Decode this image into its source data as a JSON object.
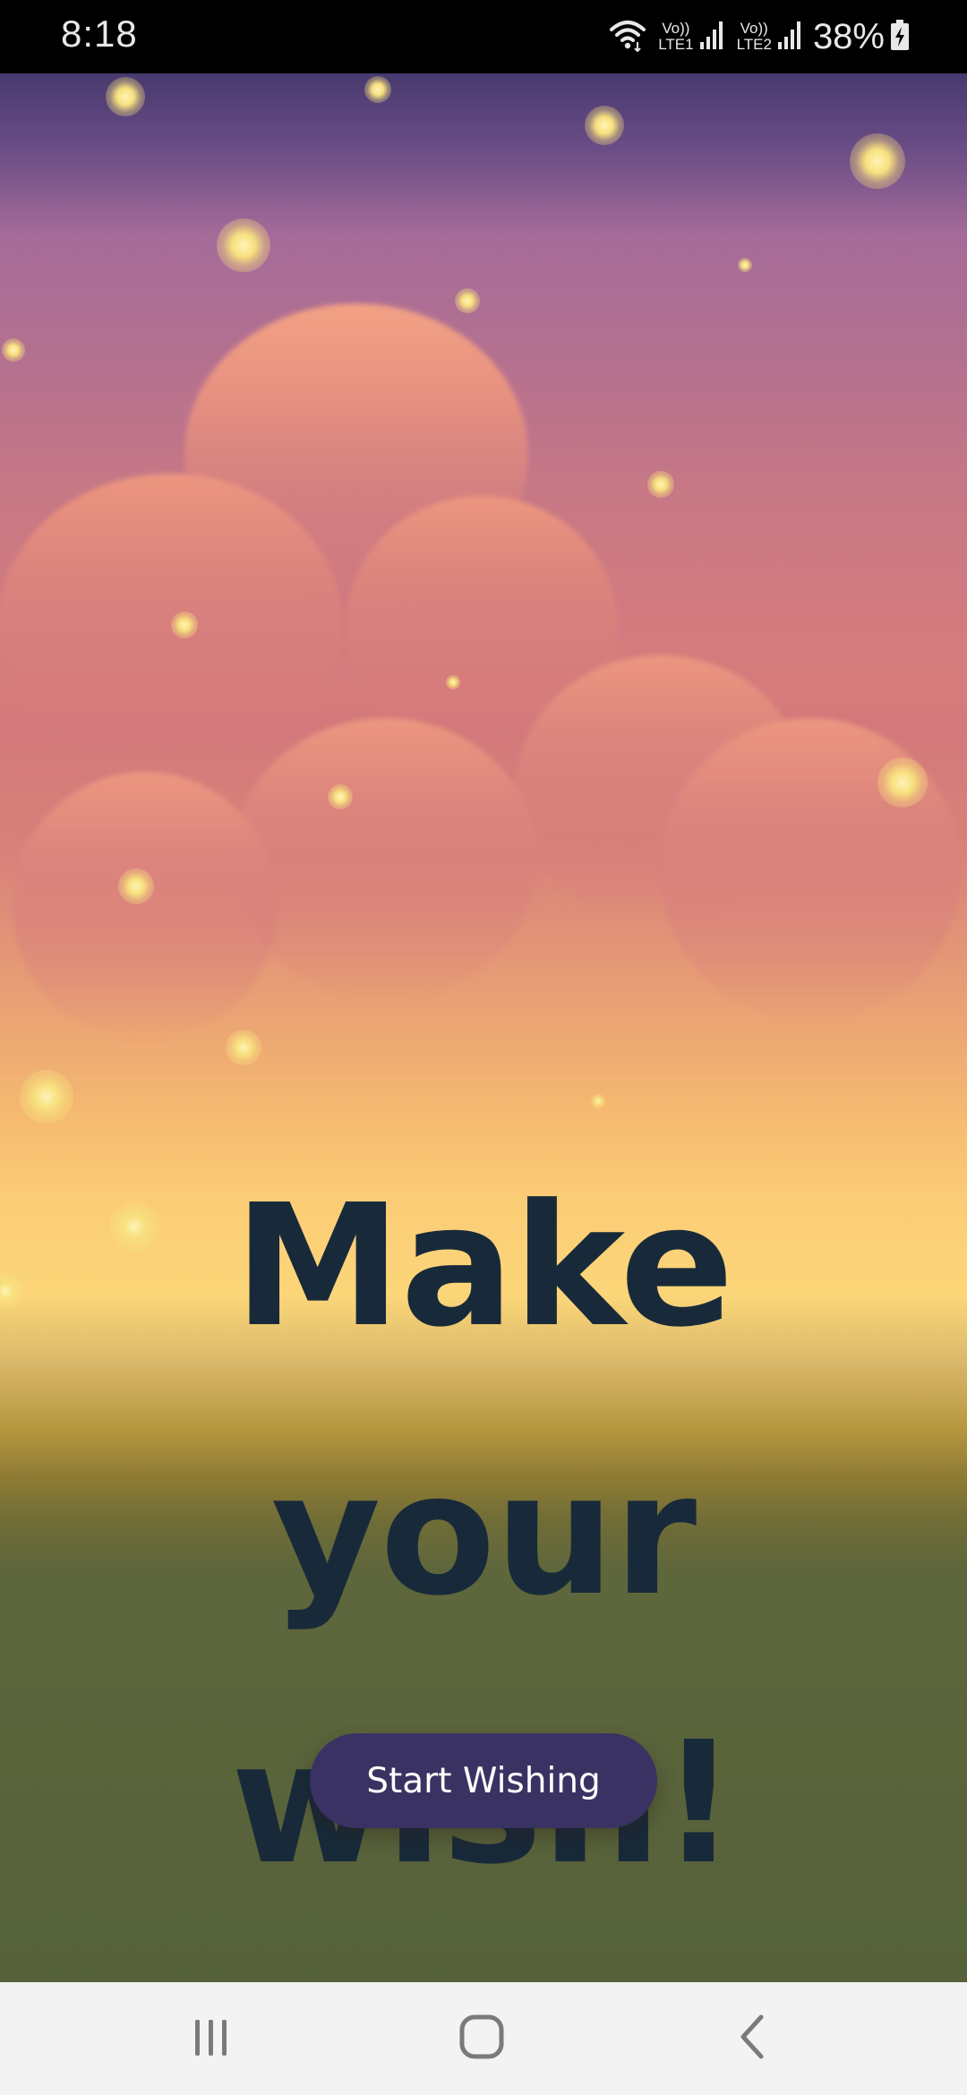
{
  "status_bar": {
    "time": "8:18",
    "sim1_top": "Vo))",
    "sim1_bottom": "LTE1",
    "sim2_top": "Vo))",
    "sim2_bottom": "LTE2",
    "battery": "38%",
    "icons": [
      "wifi-icon",
      "signal-icon",
      "signal-icon",
      "battery-charging-icon"
    ]
  },
  "main": {
    "headline_line1": "Make your",
    "headline_line2": "wish!",
    "cta_label": "Start Wishing"
  },
  "nav_bar": {
    "icons": [
      "recent-apps-icon",
      "home-icon",
      "back-icon"
    ]
  },
  "colors": {
    "headline": "#182a3a",
    "cta_background": "#3a3262",
    "cta_text": "#ffffff",
    "sky_top": "#473a6e",
    "sky_mid": "#d67b7b",
    "sky_horizon": "#fcd679",
    "ground": "#55613a",
    "star": "#f7e07e"
  }
}
